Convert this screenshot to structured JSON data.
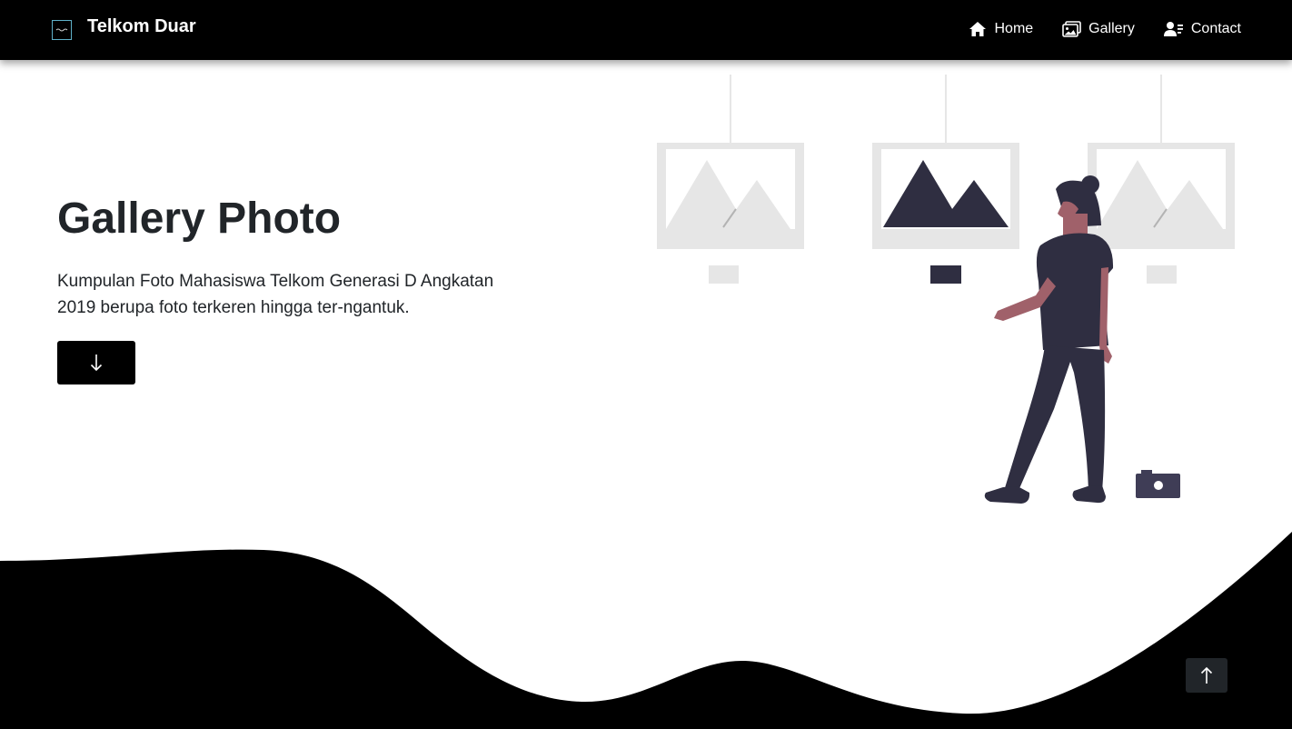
{
  "navbar": {
    "brand": "Telkom Duar",
    "links": [
      {
        "label": "Home",
        "icon": "home-icon"
      },
      {
        "label": "Gallery",
        "icon": "image-icon"
      },
      {
        "label": "Contact",
        "icon": "contact-icon"
      }
    ]
  },
  "hero": {
    "title": "Gallery Photo",
    "description": "Kumpulan Foto Mahasiswa Telkom Generasi D Angkatan 2019 berupa foto terkeren hingga ter-ngantuk."
  },
  "buttons": {
    "scroll_down_icon": "arrow-down-icon",
    "back_to_top_icon": "arrow-up-icon"
  },
  "colors": {
    "nav_bg": "#000000",
    "frame": "#e6e6e6",
    "figure": "#2f2e41",
    "skin": "#a0616a",
    "top_button": "#212529"
  }
}
